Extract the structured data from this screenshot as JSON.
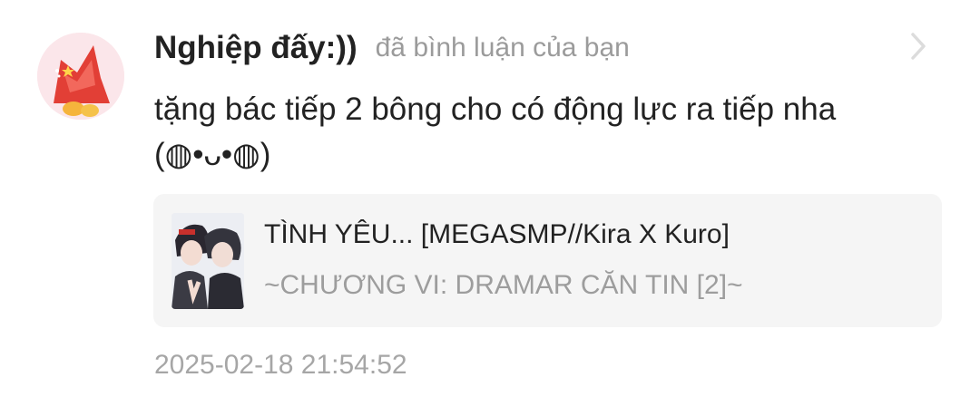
{
  "notification": {
    "avatar_icon": "user-avatar-red-fox",
    "username": "Nghiệp đấy:))",
    "action": "đã bình luận của bạn",
    "chevron_icon": "chevron-right-icon",
    "comment_lines": [
      "tặng bác tiếp 2 bông cho có động lực ra tiếp nha",
      "(◍•ᴗ•◍)"
    ],
    "story": {
      "cover_icon": "story-cover-image",
      "title": "TÌNH YÊU... [MEGASMP//Kira X Kuro]",
      "chapter": "~CHƯƠNG VI: DRAMAR CĂN TIN [2]~"
    },
    "timestamp": "2025-02-18 21:54:52"
  },
  "colors": {
    "text_primary": "#222222",
    "text_secondary": "#9b9b9b",
    "card_background": "#f5f5f5",
    "avatar_accent": "#e8413a"
  }
}
